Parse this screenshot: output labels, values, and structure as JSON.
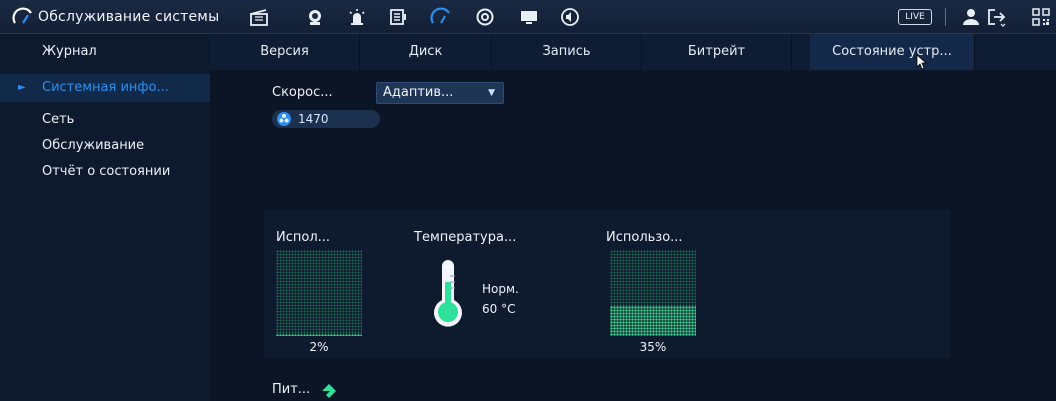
{
  "topbar": {
    "title": "Обслуживание системы",
    "live_label": "LIVE",
    "icons": [
      "maintenance-logo-icon",
      "clapper-icon",
      "face-icon",
      "alarm-icon",
      "storage-icon",
      "network-icon",
      "disc-icon",
      "display-icon",
      "audio-icon",
      "live-badge",
      "user-icon",
      "logout-icon",
      "qr-icon"
    ]
  },
  "sidebar": {
    "items": [
      {
        "label": "Журнал"
      },
      {
        "label": "Системная инфо..."
      },
      {
        "label": "Сеть"
      },
      {
        "label": "Обслуживание"
      },
      {
        "label": "Отчёт о состоянии"
      }
    ],
    "active_index": 1
  },
  "tabs": [
    {
      "label": "Версия"
    },
    {
      "label": "Диск"
    },
    {
      "label": "Запись"
    },
    {
      "label": "Битрейт"
    },
    {
      "label": "Состояние устр..."
    }
  ],
  "active_tab": 4,
  "fan": {
    "speed_label": "Скорос...",
    "mode_value": "Адаптив...",
    "rpm": "1470"
  },
  "meters": {
    "cpu": {
      "label": "Испол...",
      "value_text": "2%",
      "fill_fraction": 0.02
    },
    "temperature": {
      "label": "Температура...",
      "status": "Норм.",
      "value": "60 °C"
    },
    "memory": {
      "label": "Использо...",
      "value_text": "35%",
      "fill_fraction": 0.35
    }
  },
  "power": {
    "label": "Пит..."
  },
  "colors": {
    "accent": "#2d8ff0",
    "meter_green": "#45e3a6",
    "thermo_green": "#2fe09a"
  }
}
